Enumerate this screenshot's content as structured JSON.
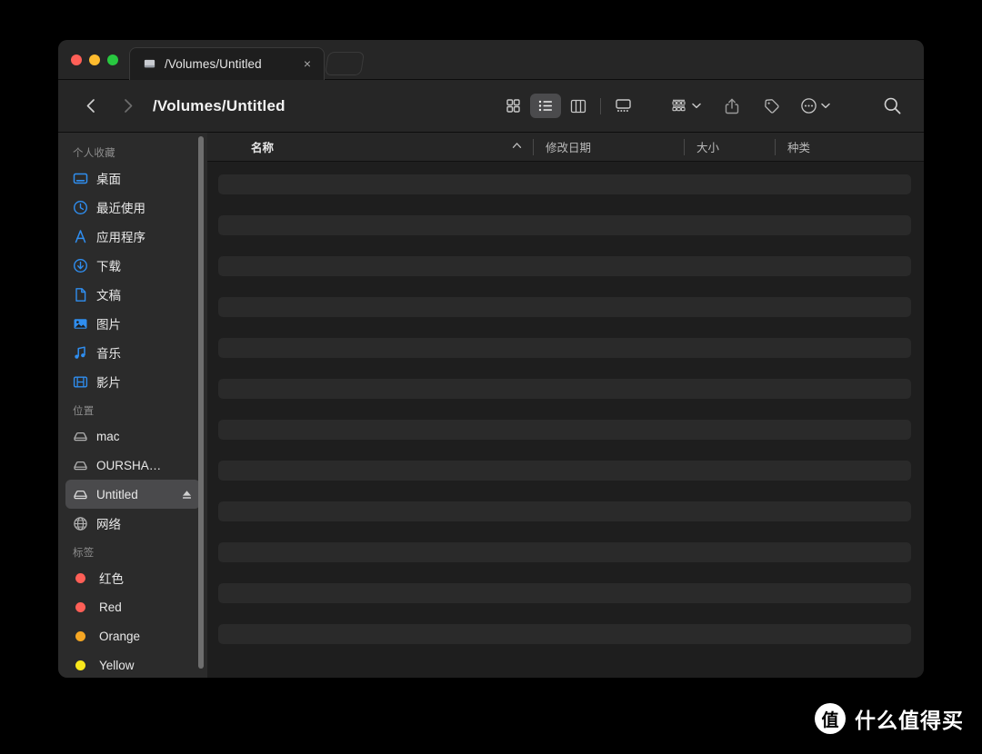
{
  "window": {
    "traffic_lights": [
      {
        "name": "close",
        "color": "#ff5f57"
      },
      {
        "name": "minimize",
        "color": "#febc2e"
      },
      {
        "name": "maximize",
        "color": "#28c840"
      }
    ]
  },
  "tabs": {
    "active": {
      "title": "/Volumes/Untitled",
      "icon": "drive-icon",
      "close_label": "×"
    },
    "new_tab_placeholder": ""
  },
  "toolbar": {
    "back_icon": "chevron-left-icon",
    "forward_icon": "chevron-right-icon",
    "path_title": "/Volumes/Untitled",
    "views": [
      {
        "name": "icon-view",
        "icon": "grid-icon",
        "active": false
      },
      {
        "name": "list-view",
        "icon": "list-icon",
        "active": true
      },
      {
        "name": "column-view",
        "icon": "columns-icon",
        "active": false
      },
      {
        "name": "gallery-view",
        "icon": "gallery-icon",
        "active": false
      }
    ],
    "actions": [
      {
        "name": "group-by",
        "icon": "group-icon",
        "has_chevron": true
      },
      {
        "name": "share",
        "icon": "share-icon",
        "has_chevron": false
      },
      {
        "name": "tags",
        "icon": "tag-icon",
        "has_chevron": false
      },
      {
        "name": "more-actions",
        "icon": "ellipsis-circle-icon",
        "has_chevron": true
      },
      {
        "name": "search",
        "icon": "search-icon",
        "has_chevron": false
      }
    ]
  },
  "sidebar": {
    "sections": [
      {
        "title": "个人收藏",
        "items": [
          {
            "label": "桌面",
            "icon": "desktop-icon",
            "type": "blue",
            "selected": false
          },
          {
            "label": "最近使用",
            "icon": "clock-icon",
            "type": "blue",
            "selected": false
          },
          {
            "label": "应用程序",
            "icon": "applications-icon",
            "type": "blue",
            "selected": false
          },
          {
            "label": "下载",
            "icon": "download-icon",
            "type": "blue",
            "selected": false
          },
          {
            "label": "文稿",
            "icon": "document-icon",
            "type": "blue",
            "selected": false
          },
          {
            "label": "图片",
            "icon": "photos-icon",
            "type": "blue",
            "selected": false
          },
          {
            "label": "音乐",
            "icon": "music-icon",
            "type": "blue",
            "selected": false
          },
          {
            "label": "影片",
            "icon": "movies-icon",
            "type": "blue",
            "selected": false
          }
        ]
      },
      {
        "title": "位置",
        "items": [
          {
            "label": "mac",
            "icon": "disk-icon",
            "type": "gray",
            "selected": false
          },
          {
            "label": "OURSHA…",
            "icon": "disk-icon",
            "type": "gray",
            "selected": false
          },
          {
            "label": "Untitled",
            "icon": "disk-icon",
            "type": "gray",
            "selected": true,
            "eject": true
          },
          {
            "label": "网络",
            "icon": "network-icon",
            "type": "gray",
            "selected": false
          }
        ]
      },
      {
        "title": "标签",
        "items": [
          {
            "label": "红色",
            "icon": "tag-dot-icon",
            "type": "dot",
            "color": "#ff5f57",
            "selected": false
          },
          {
            "label": "Red",
            "icon": "tag-dot-icon",
            "type": "dot",
            "color": "#ff5f57",
            "selected": false
          },
          {
            "label": "Orange",
            "icon": "tag-dot-icon",
            "type": "dot",
            "color": "#f5a623",
            "selected": false
          },
          {
            "label": "Yellow",
            "icon": "tag-dot-icon",
            "type": "dot",
            "color": "#f8e71c",
            "selected": false
          }
        ]
      }
    ]
  },
  "file_list": {
    "columns": [
      {
        "label": "名称",
        "key": "name",
        "sorted": true,
        "sort_direction": "asc"
      },
      {
        "label": "修改日期",
        "key": "date",
        "sorted": false
      },
      {
        "label": "大小",
        "key": "size",
        "sorted": false
      },
      {
        "label": "种类",
        "key": "kind",
        "sorted": false
      }
    ],
    "rows": [
      {
        "placeholder": true
      },
      {
        "placeholder": true
      },
      {
        "placeholder": true
      },
      {
        "placeholder": true
      },
      {
        "placeholder": true
      },
      {
        "placeholder": true
      },
      {
        "placeholder": true
      },
      {
        "placeholder": true
      },
      {
        "placeholder": true
      },
      {
        "placeholder": true
      },
      {
        "placeholder": true
      },
      {
        "placeholder": true
      }
    ]
  },
  "watermark": {
    "logo_text": "值",
    "text": "什么值得买"
  }
}
